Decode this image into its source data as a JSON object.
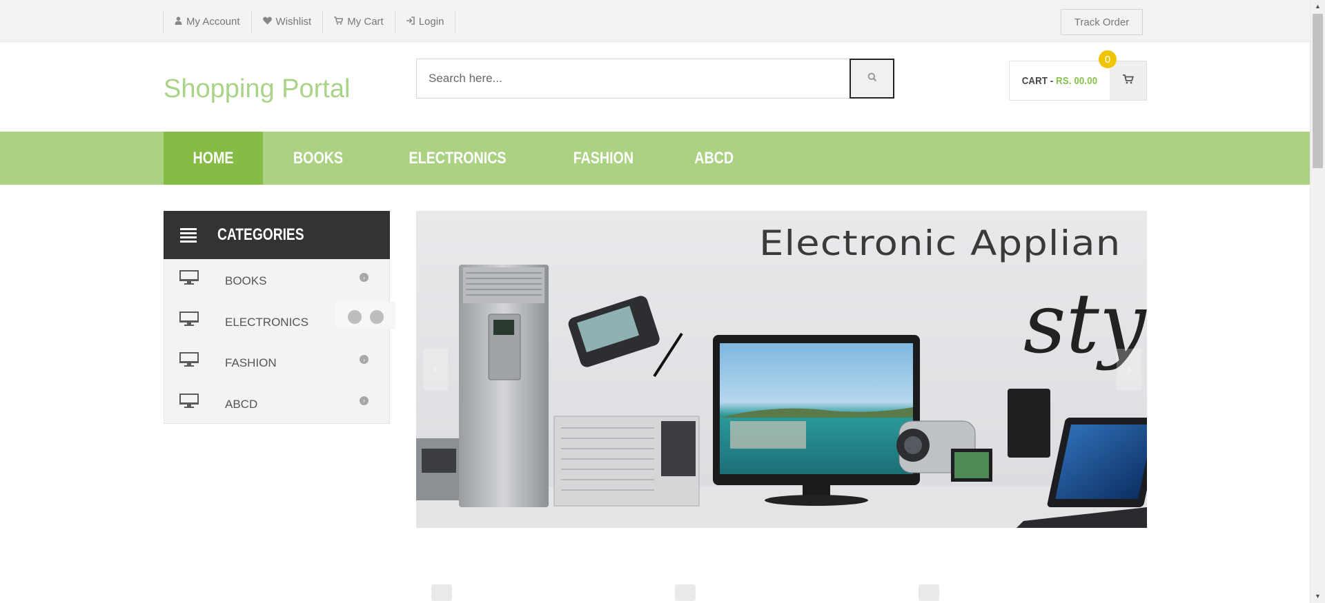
{
  "topbar": {
    "links": [
      {
        "label": "My Account",
        "icon": "user-icon"
      },
      {
        "label": "Wishlist",
        "icon": "heart-icon"
      },
      {
        "label": "My Cart",
        "icon": "cart-icon"
      },
      {
        "label": "Login",
        "icon": "sign-in-icon"
      }
    ],
    "track_order": "Track Order"
  },
  "header": {
    "logo": "Shopping Portal",
    "search_placeholder": "Search here...",
    "search_icon": "search-icon",
    "cart_label": "CART -",
    "cart_amount": "RS. 00.00",
    "cart_count": "0"
  },
  "nav": {
    "items": [
      "HOME",
      "BOOKS",
      "ELECTRONICS",
      "FASHION",
      "ABCD"
    ],
    "active": "HOME"
  },
  "categories": {
    "title": "CATEGORIES",
    "items": [
      "BOOKS",
      "ELECTRONICS",
      "FASHION",
      "ABCD"
    ]
  },
  "slider": {
    "headline": "Electronic Applian",
    "script": "sty",
    "slide_count": 2
  },
  "colors": {
    "brand_green": "#abd283",
    "active_green": "#86bb46",
    "badge_yellow": "#f0c400",
    "dark": "#333333"
  }
}
